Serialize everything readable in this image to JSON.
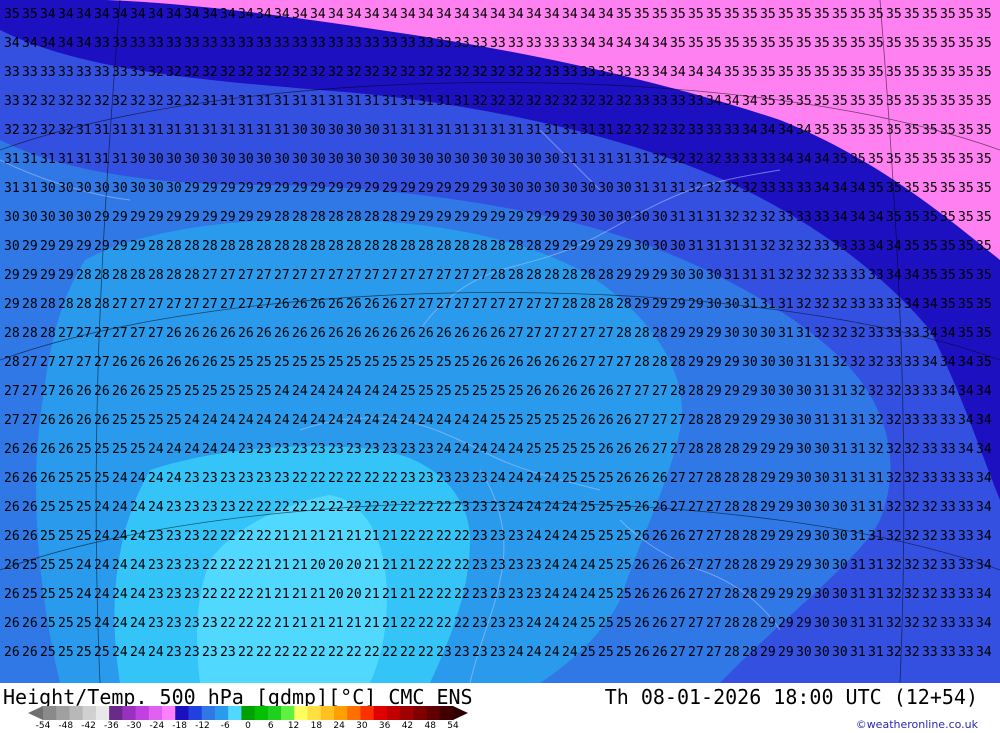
{
  "map": {
    "region": "Europe",
    "bands": [
      {
        "label": "20",
        "color": "#50d8ff"
      },
      {
        "label": "21",
        "color": "#34c4f8"
      },
      {
        "label": "22",
        "color": "#2a9aec"
      },
      {
        "label": "23",
        "color": "#2a9aec"
      },
      {
        "label": "24",
        "color": "#2f78e6"
      },
      {
        "label": "25",
        "color": "#2f78e6"
      },
      {
        "label": "26",
        "color": "#3450e0"
      },
      {
        "label": "27",
        "color": "#3450e0"
      },
      {
        "label": "28",
        "color": "#1d10c0"
      },
      {
        "label": "29",
        "color": "#1d10c0"
      },
      {
        "label": "30",
        "color": "#ff80f0"
      },
      {
        "label": "31",
        "color": "#ff80f0"
      },
      {
        "label": "32",
        "color": "#ff80f0"
      },
      {
        "label": "33",
        "color": "#ff80f0"
      },
      {
        "label": "34",
        "color": "#ff40ff"
      },
      {
        "label": "35",
        "color": "#ff40ff"
      }
    ]
  },
  "footer": {
    "title_left": "Height/Temp. 500 hPa [gdmp][°C] CMC ENS",
    "title_right": "Th 08-01-2026 18:00 UTC (12+54)",
    "credit": "©weatheronline.co.uk",
    "colorbar_colors": [
      "#8a8a8a",
      "#a0a0a0",
      "#b8b8b8",
      "#d0d0d0",
      "#e8e8e8",
      "#6a2a8a",
      "#9a30c0",
      "#c040e0",
      "#e060f0",
      "#ff80ff",
      "#1a10c0",
      "#2040e0",
      "#2f78e6",
      "#2a9aec",
      "#50d8ff",
      "#00a000",
      "#00c000",
      "#20d020",
      "#60f040",
      "#ffff60",
      "#ffe040",
      "#ffc020",
      "#ffa000",
      "#ff7000",
      "#ff3000",
      "#e00000",
      "#c00000",
      "#a00000",
      "#800000",
      "#600000",
      "#400000"
    ],
    "colorbar_ticks": [
      "-54",
      "-48",
      "-42",
      "-36",
      "-30",
      "-24",
      "-18",
      "-12",
      "-6",
      "0",
      "6",
      "12",
      "18",
      "24",
      "30",
      "36",
      "42",
      "48",
      "54"
    ]
  }
}
